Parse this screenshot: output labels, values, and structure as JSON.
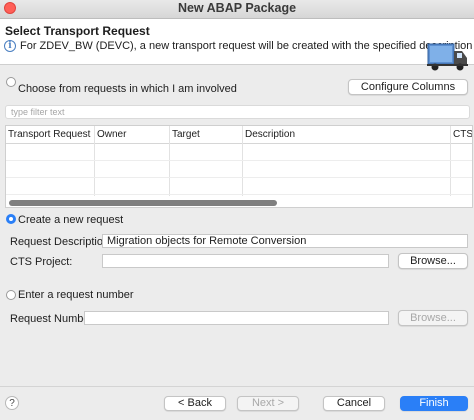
{
  "window": {
    "title": "New ABAP Package"
  },
  "header": {
    "title": "Select Transport Request",
    "description": "For ZDEV_BW (DEVC), a new transport request will be created with the specified description",
    "info_icon": "info-icon",
    "image_icon": "transport-truck-icon"
  },
  "choose_section": {
    "radio_label": "Choose from requests in which I am involved",
    "configure_columns_label": "Configure Columns",
    "filter_placeholder": "type filter text",
    "table": {
      "columns": [
        "Transport Request",
        "Owner",
        "Target",
        "Description",
        "CTS P"
      ],
      "rows": []
    }
  },
  "create_section": {
    "radio_label": "Create a new request",
    "selected": true,
    "request_description_label": "Request Description: *",
    "request_description_value": "Migration objects for Remote Conversion",
    "cts_project_label": "CTS Project:",
    "cts_project_value": "",
    "browse_label": "Browse..."
  },
  "number_section": {
    "radio_label": "Enter a request number",
    "request_number_label": "Request Number:",
    "request_number_value": "",
    "browse_label": "Browse..."
  },
  "footer": {
    "help_label": "?",
    "back_label": "< Back",
    "next_label": "Next >",
    "cancel_label": "Cancel",
    "finish_label": "Finish"
  },
  "colors": {
    "accent": "#2a7ff7",
    "close": "#ff5f57"
  }
}
